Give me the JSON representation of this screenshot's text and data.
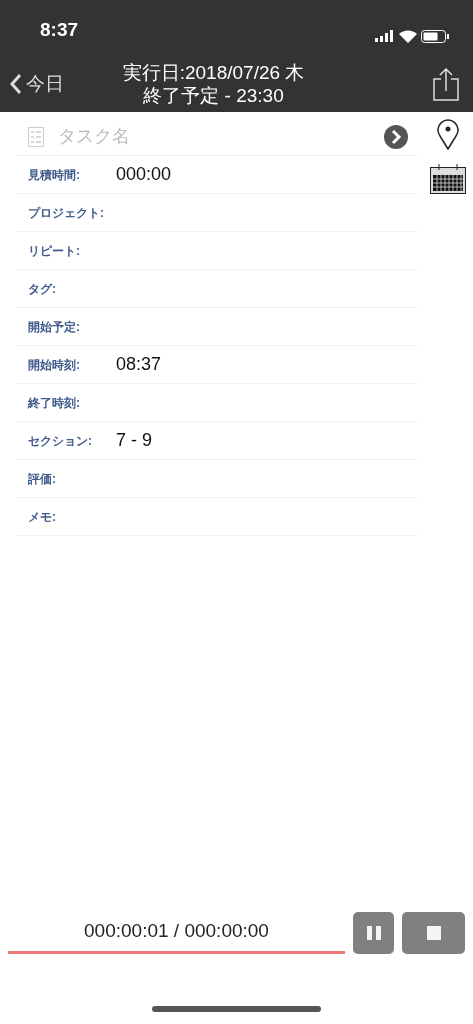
{
  "status_bar": {
    "time": "8:37"
  },
  "nav": {
    "back": "今日",
    "title_line1": "実行日:2018/07/26 木",
    "title_line2": "終了予定 - 23:30"
  },
  "task_name": {
    "placeholder": "タスク名"
  },
  "fields": [
    {
      "label": "見積時間:",
      "value": "000:00"
    },
    {
      "label": "プロジェクト:"
    },
    {
      "label": "リピート:"
    },
    {
      "label": "タグ:"
    },
    {
      "label": "開始予定:"
    },
    {
      "label": "開始時刻:",
      "value": "08:37"
    },
    {
      "label": "終了時刻:"
    },
    {
      "label": "セクション:",
      "value": "7 - 9"
    },
    {
      "label": "評価:"
    },
    {
      "label": "メモ:"
    }
  ],
  "timer": {
    "reading": "000:00:01 / 000:00:00"
  }
}
